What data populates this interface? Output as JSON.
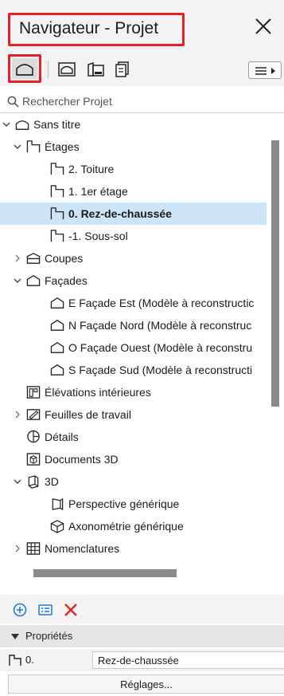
{
  "window": {
    "title": "Navigateur - Projet"
  },
  "search": {
    "placeholder": "Rechercher Projet"
  },
  "tree": [
    {
      "label": "Sans titre",
      "icon": "project-icon",
      "depth": 0,
      "caret": "down",
      "selected": false
    },
    {
      "label": "Étages",
      "icon": "story-icon",
      "depth": 1,
      "caret": "down",
      "selected": false
    },
    {
      "label": "2. Toiture",
      "icon": "story-icon",
      "depth": 2,
      "caret": "none",
      "selected": false
    },
    {
      "label": "1. 1er étage",
      "icon": "story-icon",
      "depth": 2,
      "caret": "none",
      "selected": false
    },
    {
      "label": "0. Rez-de-chaussée",
      "icon": "story-icon",
      "depth": 2,
      "caret": "none",
      "selected": true
    },
    {
      "label": "-1. Sous-sol",
      "icon": "story-icon",
      "depth": 2,
      "caret": "none",
      "selected": false
    },
    {
      "label": "Coupes",
      "icon": "section-icon",
      "depth": 1,
      "caret": "right",
      "selected": false
    },
    {
      "label": "Façades",
      "icon": "elevation-icon",
      "depth": 1,
      "caret": "down",
      "selected": false
    },
    {
      "label": "E Façade Est (Modèle à reconstructic",
      "icon": "elevation-icon",
      "depth": 2,
      "caret": "none",
      "selected": false
    },
    {
      "label": "N Façade Nord (Modèle à reconstruc",
      "icon": "elevation-icon",
      "depth": 2,
      "caret": "none",
      "selected": false
    },
    {
      "label": "O Façade Ouest (Modèle à reconstru",
      "icon": "elevation-icon",
      "depth": 2,
      "caret": "none",
      "selected": false
    },
    {
      "label": "S Façade Sud (Modèle à reconstructi",
      "icon": "elevation-icon",
      "depth": 2,
      "caret": "none",
      "selected": false
    },
    {
      "label": "Élévations intérieures",
      "icon": "interior-elevation-icon",
      "depth": 1,
      "caret": "none",
      "selected": false
    },
    {
      "label": "Feuilles de travail",
      "icon": "worksheet-icon",
      "depth": 1,
      "caret": "right",
      "selected": false
    },
    {
      "label": "Détails",
      "icon": "detail-icon",
      "depth": 1,
      "caret": "none",
      "selected": false
    },
    {
      "label": "Documents 3D",
      "icon": "document-3d-icon",
      "depth": 1,
      "caret": "none",
      "selected": false
    },
    {
      "label": "3D",
      "icon": "3d-icon",
      "depth": 1,
      "caret": "down",
      "selected": false
    },
    {
      "label": "Perspective générique",
      "icon": "perspective-icon",
      "depth": 2,
      "caret": "none",
      "selected": false
    },
    {
      "label": "Axonométrie générique",
      "icon": "axonometry-icon",
      "depth": 2,
      "caret": "none",
      "selected": false
    },
    {
      "label": "Nomenclatures",
      "icon": "schedule-icon",
      "depth": 1,
      "caret": "right",
      "selected": false
    }
  ],
  "properties": {
    "header": "Propriétés",
    "id_value": "0.",
    "name_value": "Rez-de-chaussée",
    "settings_label": "Réglages..."
  },
  "colors": {
    "highlight_border": "#e5202a",
    "selection": "#cce4f7",
    "action_add": "#1e7bd6",
    "action_delete": "#e5202a"
  }
}
